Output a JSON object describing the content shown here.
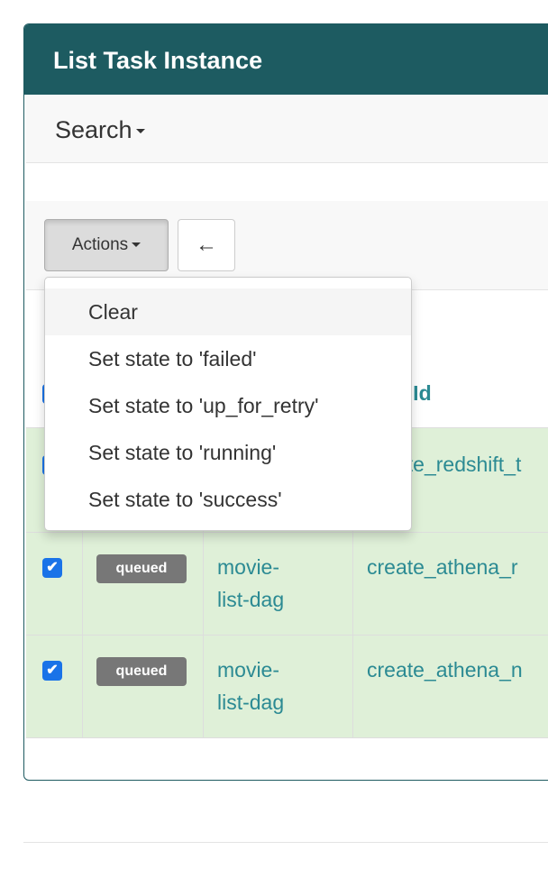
{
  "panel": {
    "title": "List Task Instance"
  },
  "search": {
    "label": "Search"
  },
  "toolbar": {
    "actions_label": "Actions",
    "back_icon": "←"
  },
  "dropdown": {
    "items": [
      {
        "label": "Clear"
      },
      {
        "label": "Set state to 'failed'"
      },
      {
        "label": "Set state to 'up_for_retry'"
      },
      {
        "label": "Set state to 'running'"
      },
      {
        "label": "Set state to 'success'"
      }
    ]
  },
  "table": {
    "header": {
      "task_id_label": "k Id"
    },
    "rows": [
      {
        "checked": "✔",
        "state": "",
        "dag_id": "",
        "task_id": "ate_redshift_t"
      },
      {
        "checked": "✔",
        "state": "queued",
        "dag_id_line1": "movie-",
        "dag_id_line2": "list-dag",
        "task_id": "create_athena_r"
      },
      {
        "checked": "✔",
        "state": "queued",
        "dag_id_line1": "movie-",
        "dag_id_line2": "list-dag",
        "task_id": "create_athena_n"
      }
    ]
  },
  "colors": {
    "heading_bg": "#1d5b61",
    "row_success_bg": "#dff0d8",
    "link": "#2b8a93",
    "badge_bg": "#777777",
    "checkbox": "#1a73e8"
  }
}
